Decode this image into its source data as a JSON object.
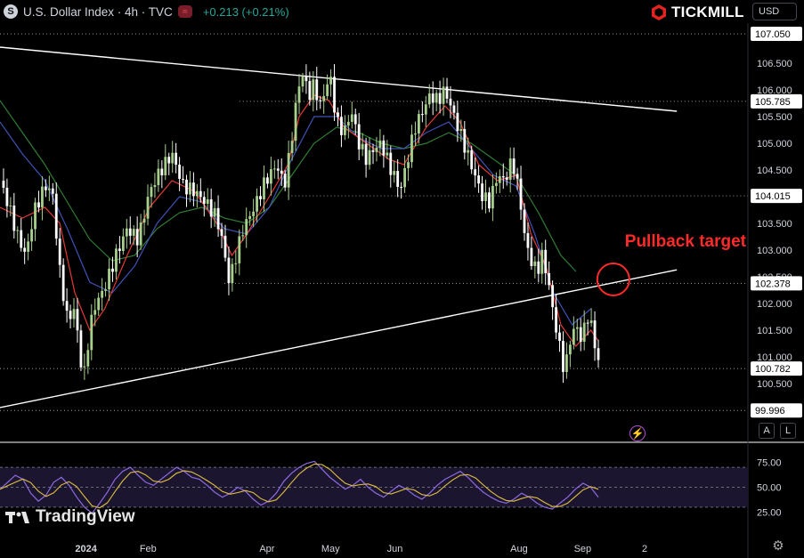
{
  "header": {
    "symbol_icon_letter": "S",
    "title": "U.S. Dollar Index · 4h · TVC",
    "change": "+0.213 (+0.21%)"
  },
  "brand": {
    "name": "TICKMILL"
  },
  "currency_selector": {
    "value": "USD"
  },
  "buttons": {
    "auto": "A",
    "log": "L"
  },
  "watermark": {
    "text": "TradingView"
  },
  "annotation": {
    "text": "Pullback target"
  },
  "colors": {
    "background": "#000000",
    "up_candle": "#a8d08d",
    "down_candle": "#ffffff",
    "ema_fast": "#e53935",
    "ema_mid": "#3f51b5",
    "ema_slow": "#2e7d32",
    "trendline": "#ffffff",
    "annotation": "#ff2a2a",
    "rsi_line": "#8c6be0",
    "rsi_signal": "#e0c040"
  },
  "chart_data": {
    "type": "line",
    "price_axis": {
      "ticks": [
        100.5,
        101.0,
        101.5,
        102.0,
        102.5,
        103.0,
        103.5,
        104.0,
        104.5,
        105.0,
        105.5,
        106.0,
        106.5
      ],
      "tick_labels": [
        "100.500",
        "101.000",
        "101.500",
        "102.000",
        "102.500",
        "103.000",
        "103.500",
        "104.000",
        "104.500",
        "105.000",
        "105.500",
        "106.000",
        "106.500"
      ],
      "ylim": [
        99.85,
        107.25
      ]
    },
    "price_labels": [
      {
        "value": 107.05,
        "text": "107.050"
      },
      {
        "value": 105.785,
        "text": "105.785"
      },
      {
        "value": 104.015,
        "text": "104.015"
      },
      {
        "value": 102.378,
        "text": "102.378"
      },
      {
        "value": 100.782,
        "text": "100.782"
      },
      {
        "value": 99.996,
        "text": "99.996"
      }
    ],
    "time_axis": {
      "labels": [
        {
          "text": "2024",
          "t": 0.115,
          "bold": true
        },
        {
          "text": "Feb",
          "t": 0.198
        },
        {
          "text": "Apr",
          "t": 0.357
        },
        {
          "text": "May",
          "t": 0.442
        },
        {
          "text": "Jun",
          "t": 0.528
        },
        {
          "text": "Aug",
          "t": 0.694
        },
        {
          "text": "Sep",
          "t": 0.779
        },
        {
          "text": "2",
          "t": 0.862
        }
      ]
    },
    "price_path": [
      [
        0.0,
        104.3
      ],
      [
        0.01,
        103.9
      ],
      [
        0.025,
        103.2
      ],
      [
        0.035,
        102.9
      ],
      [
        0.045,
        103.7
      ],
      [
        0.06,
        104.2
      ],
      [
        0.07,
        104.1
      ],
      [
        0.08,
        102.6
      ],
      [
        0.09,
        101.7
      ],
      [
        0.1,
        101.9
      ],
      [
        0.108,
        100.9
      ],
      [
        0.113,
        100.7
      ],
      [
        0.118,
        101.3
      ],
      [
        0.125,
        101.9
      ],
      [
        0.14,
        102.3
      ],
      [
        0.155,
        102.9
      ],
      [
        0.17,
        103.4
      ],
      [
        0.185,
        103.2
      ],
      [
        0.2,
        104.1
      ],
      [
        0.215,
        104.5
      ],
      [
        0.23,
        104.8
      ],
      [
        0.245,
        104.2
      ],
      [
        0.26,
        104.1
      ],
      [
        0.275,
        103.9
      ],
      [
        0.29,
        103.6
      ],
      [
        0.3,
        103.0
      ],
      [
        0.305,
        102.4
      ],
      [
        0.312,
        102.7
      ],
      [
        0.325,
        103.4
      ],
      [
        0.34,
        103.8
      ],
      [
        0.355,
        104.3
      ],
      [
        0.37,
        104.6
      ],
      [
        0.38,
        104.2
      ],
      [
        0.385,
        104.6
      ],
      [
        0.392,
        105.3
      ],
      [
        0.398,
        106.0
      ],
      [
        0.405,
        106.3
      ],
      [
        0.413,
        105.9
      ],
      [
        0.42,
        106.1
      ],
      [
        0.428,
        105.7
      ],
      [
        0.435,
        106.0
      ],
      [
        0.441,
        106.3
      ],
      [
        0.45,
        105.4
      ],
      [
        0.46,
        105.2
      ],
      [
        0.47,
        105.6
      ],
      [
        0.48,
        105.0
      ],
      [
        0.49,
        104.7
      ],
      [
        0.5,
        104.9
      ],
      [
        0.51,
        105.0
      ],
      [
        0.52,
        104.6
      ],
      [
        0.53,
        104.3
      ],
      [
        0.535,
        104.1
      ],
      [
        0.545,
        104.7
      ],
      [
        0.555,
        105.3
      ],
      [
        0.565,
        105.6
      ],
      [
        0.575,
        105.9
      ],
      [
        0.585,
        105.8
      ],
      [
        0.595,
        106.0
      ],
      [
        0.605,
        105.6
      ],
      [
        0.615,
        105.2
      ],
      [
        0.625,
        104.8
      ],
      [
        0.635,
        104.4
      ],
      [
        0.645,
        104.0
      ],
      [
        0.655,
        103.9
      ],
      [
        0.665,
        104.4
      ],
      [
        0.675,
        104.3
      ],
      [
        0.685,
        104.7
      ],
      [
        0.695,
        104.0
      ],
      [
        0.702,
        103.2
      ],
      [
        0.71,
        102.8
      ],
      [
        0.718,
        102.6
      ],
      [
        0.725,
        102.9
      ],
      [
        0.732,
        102.5
      ],
      [
        0.74,
        101.8
      ],
      [
        0.748,
        101.2
      ],
      [
        0.755,
        100.7
      ],
      [
        0.762,
        101.3
      ],
      [
        0.77,
        101.6
      ],
      [
        0.778,
        101.3
      ],
      [
        0.785,
        101.8
      ],
      [
        0.792,
        101.5
      ],
      [
        0.8,
        100.9
      ]
    ],
    "ema_fast": [
      [
        0.0,
        103.8
      ],
      [
        0.03,
        103.6
      ],
      [
        0.06,
        103.8
      ],
      [
        0.08,
        103.5
      ],
      [
        0.1,
        102.2
      ],
      [
        0.12,
        101.5
      ],
      [
        0.14,
        101.9
      ],
      [
        0.17,
        102.9
      ],
      [
        0.2,
        103.8
      ],
      [
        0.23,
        104.3
      ],
      [
        0.26,
        104.1
      ],
      [
        0.29,
        103.5
      ],
      [
        0.31,
        102.9
      ],
      [
        0.33,
        103.3
      ],
      [
        0.36,
        104.0
      ],
      [
        0.385,
        104.6
      ],
      [
        0.4,
        105.5
      ],
      [
        0.42,
        105.9
      ],
      [
        0.44,
        105.8
      ],
      [
        0.46,
        105.3
      ],
      [
        0.49,
        105.0
      ],
      [
        0.52,
        104.7
      ],
      [
        0.54,
        104.6
      ],
      [
        0.57,
        105.3
      ],
      [
        0.595,
        105.7
      ],
      [
        0.615,
        105.4
      ],
      [
        0.64,
        104.6
      ],
      [
        0.665,
        104.3
      ],
      [
        0.69,
        104.4
      ],
      [
        0.71,
        103.3
      ],
      [
        0.73,
        102.7
      ],
      [
        0.75,
        101.6
      ],
      [
        0.77,
        101.2
      ],
      [
        0.79,
        101.5
      ],
      [
        0.8,
        101.3
      ]
    ],
    "ema_mid": [
      [
        0.0,
        105.4
      ],
      [
        0.03,
        104.8
      ],
      [
        0.06,
        104.3
      ],
      [
        0.09,
        103.4
      ],
      [
        0.12,
        102.4
      ],
      [
        0.15,
        102.2
      ],
      [
        0.18,
        102.7
      ],
      [
        0.21,
        103.5
      ],
      [
        0.24,
        104.0
      ],
      [
        0.27,
        103.9
      ],
      [
        0.3,
        103.4
      ],
      [
        0.33,
        103.3
      ],
      [
        0.36,
        103.8
      ],
      [
        0.39,
        104.7
      ],
      [
        0.42,
        105.5
      ],
      [
        0.45,
        105.5
      ],
      [
        0.48,
        105.1
      ],
      [
        0.51,
        104.9
      ],
      [
        0.54,
        104.9
      ],
      [
        0.57,
        105.2
      ],
      [
        0.6,
        105.4
      ],
      [
        0.63,
        104.9
      ],
      [
        0.66,
        104.4
      ],
      [
        0.69,
        104.2
      ],
      [
        0.715,
        103.3
      ],
      [
        0.74,
        102.2
      ],
      [
        0.765,
        101.6
      ],
      [
        0.79,
        101.9
      ]
    ],
    "ema_slow": [
      [
        0.0,
        105.8
      ],
      [
        0.03,
        105.2
      ],
      [
        0.06,
        104.6
      ],
      [
        0.09,
        103.9
      ],
      [
        0.12,
        103.2
      ],
      [
        0.15,
        102.8
      ],
      [
        0.18,
        102.9
      ],
      [
        0.21,
        103.4
      ],
      [
        0.24,
        103.7
      ],
      [
        0.27,
        103.8
      ],
      [
        0.3,
        103.6
      ],
      [
        0.33,
        103.5
      ],
      [
        0.36,
        103.8
      ],
      [
        0.39,
        104.4
      ],
      [
        0.42,
        105.0
      ],
      [
        0.45,
        105.3
      ],
      [
        0.48,
        105.2
      ],
      [
        0.51,
        105.0
      ],
      [
        0.54,
        104.9
      ],
      [
        0.57,
        105.0
      ],
      [
        0.6,
        105.2
      ],
      [
        0.63,
        105.0
      ],
      [
        0.66,
        104.7
      ],
      [
        0.69,
        104.4
      ],
      [
        0.72,
        103.7
      ],
      [
        0.75,
        102.9
      ],
      [
        0.77,
        102.6
      ]
    ],
    "trendlines": [
      {
        "name": "upper",
        "from": [
          0.0,
          106.8
        ],
        "to": [
          0.905,
          105.6
        ]
      },
      {
        "name": "lower",
        "from": [
          0.0,
          100.05
        ],
        "to": [
          0.905,
          102.63
        ]
      }
    ],
    "dotted_levels": [
      {
        "value": 107.05,
        "from": 0.0
      },
      {
        "value": 105.785,
        "from": 0.32
      },
      {
        "value": 104.015,
        "from": 0.385
      },
      {
        "value": 102.378,
        "from": 0.3
      },
      {
        "value": 100.782,
        "from": 0.0
      },
      {
        "value": 99.996,
        "from": 0.0
      }
    ],
    "target_circle": {
      "t": 0.82,
      "value": 102.45
    },
    "rsi": {
      "ticks": [
        25,
        50,
        75
      ],
      "tick_labels": [
        "25.00",
        "50.00",
        "75.00"
      ],
      "ylim": [
        12,
        88
      ],
      "band": [
        30,
        70
      ],
      "values": [
        48,
        55,
        62,
        58,
        44,
        36,
        42,
        55,
        60,
        52,
        40,
        30,
        24,
        34,
        45,
        58,
        66,
        70,
        62,
        55,
        52,
        58,
        64,
        70,
        66,
        60,
        58,
        52,
        45,
        40,
        44,
        50,
        46,
        38,
        32,
        36,
        44,
        56,
        64,
        70,
        74,
        76,
        68,
        60,
        54,
        48,
        52,
        58,
        50,
        44,
        40,
        46,
        52,
        48,
        42,
        38,
        44,
        52,
        58,
        62,
        66,
        60,
        52,
        45,
        40,
        36,
        34,
        38,
        44,
        40,
        34,
        30,
        28,
        34,
        40,
        48,
        54,
        50,
        40
      ]
    }
  }
}
